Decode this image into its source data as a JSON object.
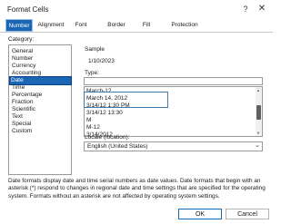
{
  "window": {
    "title": "Format Cells",
    "help_glyph": "?",
    "close_glyph": "✕"
  },
  "tabs": [
    {
      "label": "Number",
      "active": true
    },
    {
      "label": "Alignment",
      "active": false
    },
    {
      "label": "Font",
      "active": false
    },
    {
      "label": "Border",
      "active": false
    },
    {
      "label": "Fill",
      "active": false
    },
    {
      "label": "Protection",
      "active": false
    }
  ],
  "category": {
    "label": "Category:",
    "items": [
      "General",
      "Number",
      "Currency",
      "Accounting",
      "Date",
      "Time",
      "Percentage",
      "Fraction",
      "Scientific",
      "Text",
      "Special",
      "Custom"
    ],
    "selected": "Date"
  },
  "sample": {
    "label": "Sample",
    "value": "1/10/2023"
  },
  "type": {
    "label": "Type:",
    "input_value": "",
    "items": [
      "March-12",
      "March 14, 2012",
      "3/14/12 1:30 PM",
      "3/14/12 13:30",
      "M",
      "M-12",
      "3/14/2012"
    ],
    "highlighted": [
      "3/14/12 1:30 PM",
      "3/14/12 13:30"
    ]
  },
  "locale": {
    "label": "Locale (location):",
    "value": "English (United States)"
  },
  "description": "Date formats display date and time serial numbers as date values. Date formats that begin with an asterisk (*) respond to changes in regional date and time settings that are specified for the operating system. Formats without an asterisk are not affected by operating system settings.",
  "buttons": {
    "ok": "OK",
    "cancel": "Cancel"
  },
  "colors": {
    "accent": "#1a66b5",
    "highlight_border": "#3d7bb5"
  }
}
